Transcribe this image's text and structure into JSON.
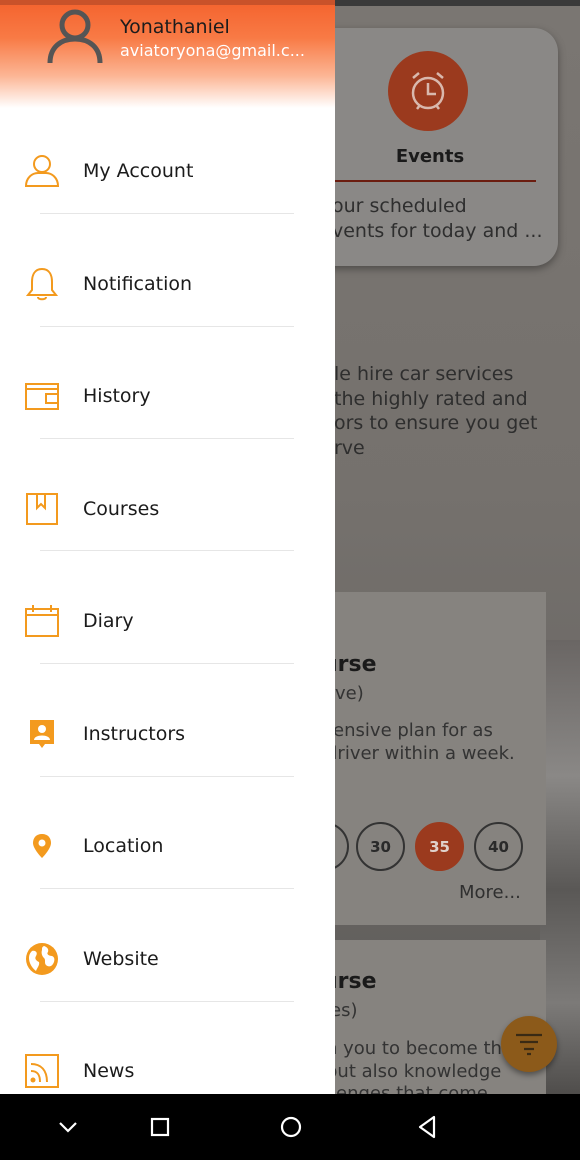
{
  "background": {
    "events_card": {
      "title": "Events",
      "description": "our scheduled\nvents for today and ..."
    },
    "promo_text": "le hire car services\nthe highly rated and\nors to ensure you get\nrve",
    "course_card_1": {
      "title": "urse",
      "subtitle": "ive)",
      "description": "tensive plan for as\ndriver within a week.",
      "hour_options": [
        "30",
        "35",
        "40"
      ],
      "selected_option": "35",
      "more_label": "More..."
    },
    "course_card_2": {
      "title": "urse",
      "subtitle": "es)",
      "description": "n you to become th\n but also knowledge\nllenges that come"
    },
    "accent_color": "#f4622d"
  },
  "drawer": {
    "user": {
      "name": "Yonathaniel",
      "email": "aviatoryona@gmail.c..."
    },
    "items": [
      {
        "label": "My Account",
        "icon": "user-icon"
      },
      {
        "label": "Notification",
        "icon": "bell-icon"
      },
      {
        "label": "History",
        "icon": "wallet-icon"
      },
      {
        "label": "Courses",
        "icon": "bookmark-icon"
      },
      {
        "label": "Diary",
        "icon": "calendar-icon"
      },
      {
        "label": "Instructors",
        "icon": "contact-card-icon"
      },
      {
        "label": "Location",
        "icon": "location-pin-icon"
      },
      {
        "label": "Website",
        "icon": "globe-icon"
      },
      {
        "label": "News",
        "icon": "rss-icon"
      }
    ],
    "icon_color": "#f39a1e"
  },
  "system_nav": {
    "buttons": [
      "chevron-down",
      "recents",
      "home",
      "back"
    ]
  }
}
